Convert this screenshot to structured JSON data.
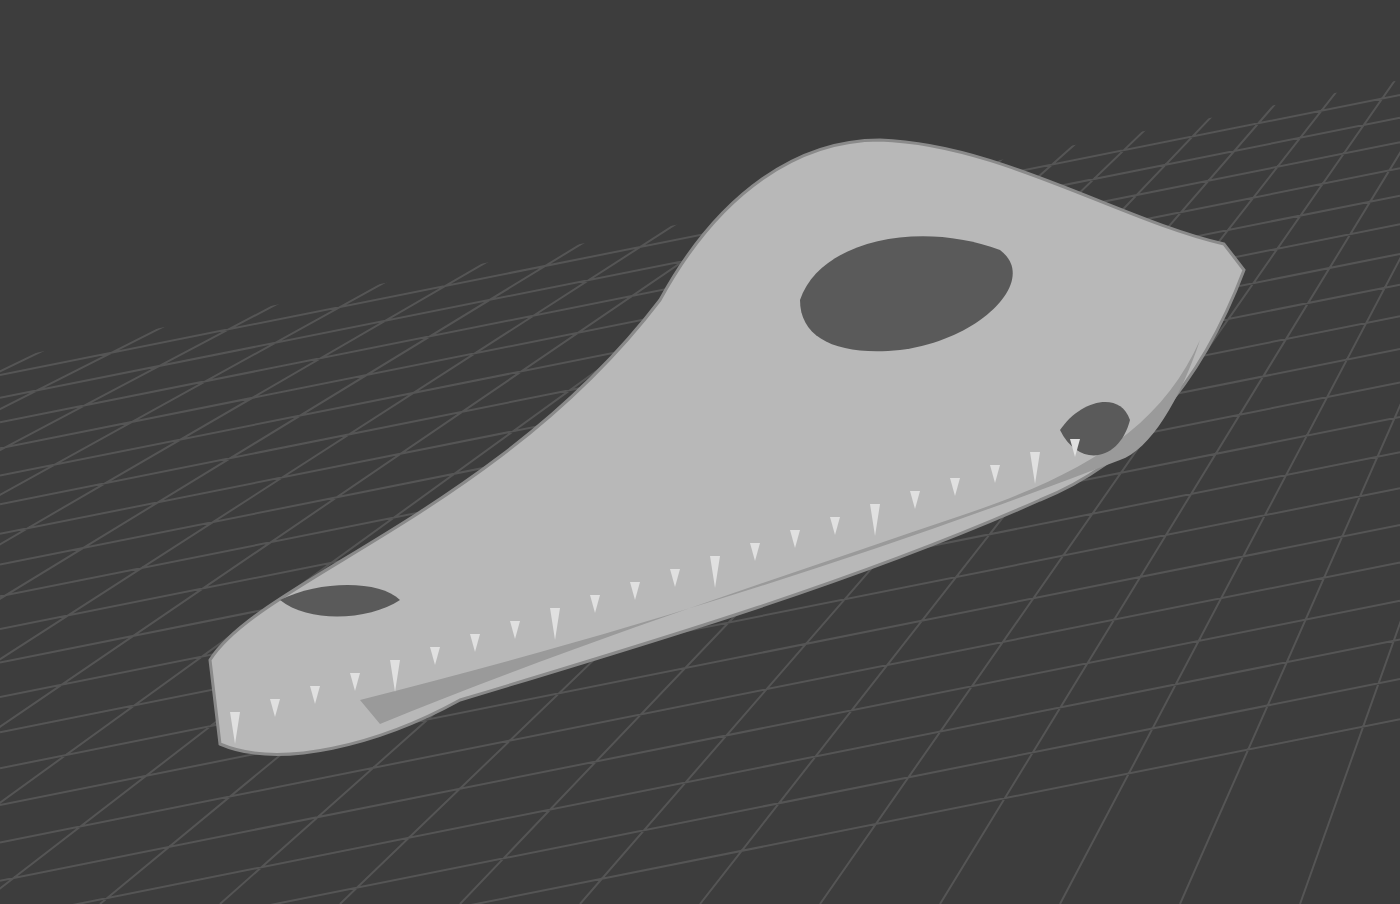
{
  "viewport": {
    "kind": "model-viewport"
  }
}
